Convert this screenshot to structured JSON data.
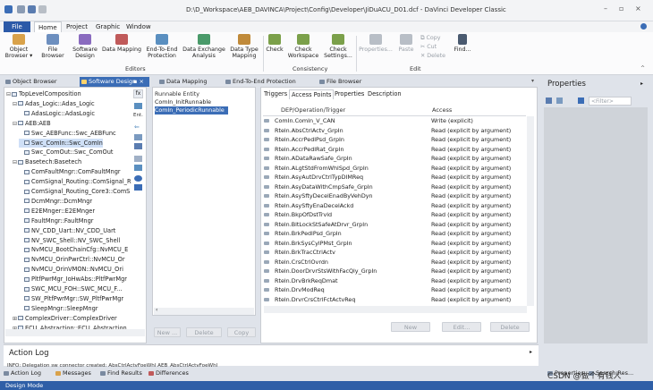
{
  "title_bar": {
    "title": "D:\\D_Workspace\\AEB_DAVINCA\\Project\\Config\\Developer\\JiDuACU_D01.dcf - DaVinci Developer Classic",
    "minimize": "–",
    "restore": "▫",
    "close": "×"
  },
  "menu": [
    "File",
    "Home",
    "Project",
    "Graphic",
    "Window"
  ],
  "ribbon": {
    "buttons": [
      {
        "label1": "Object",
        "label2": "Browser ▾",
        "icon": "object-browser-icon",
        "color": "#d9a24a"
      },
      {
        "label1": "File",
        "label2": "Browser",
        "icon": "file-browser-icon",
        "color": "#6d8fbf"
      },
      {
        "label1": "Software",
        "label2": "Design",
        "icon": "software-design-icon",
        "color": "#8a6bbf"
      },
      {
        "label1": "Data Mapping",
        "label2": "",
        "icon": "data-mapping-icon",
        "color": "#c05a5a"
      },
      {
        "label1": "End-To-End",
        "label2": "Protection",
        "icon": "end-to-end-icon",
        "color": "#5a8fc0"
      },
      {
        "label1": "Data Exchange",
        "label2": "Analysis",
        "icon": "data-exchange-icon",
        "color": "#4a9a6a"
      },
      {
        "label1": "Data Type",
        "label2": "Mapping",
        "icon": "data-type-mapping-icon",
        "color": "#c08a3a"
      },
      {
        "label1": "Check",
        "label2": "",
        "icon": "check-icon",
        "color": "#7ba04a"
      },
      {
        "label1": "Check",
        "label2": "Workspace",
        "icon": "check-workspace-icon",
        "color": "#7ba04a"
      },
      {
        "label1": "Check",
        "label2": "Settings...",
        "icon": "check-settings-icon",
        "color": "#7ba04a"
      },
      {
        "label1": "Properties...",
        "label2": "",
        "icon": "properties-icon",
        "color": "#b8bec6"
      },
      {
        "label1": "Paste",
        "label2": "",
        "icon": "paste-icon",
        "color": "#b8bec6"
      },
      {
        "label1": "Find...",
        "label2": "",
        "icon": "find-icon",
        "color": "#4a5a70"
      }
    ],
    "small": [
      "Copy",
      "Cut",
      "Delete"
    ],
    "groups": [
      "Editors",
      "Consistency",
      "Edit"
    ]
  },
  "doc_tabs": [
    {
      "label": "Object Browser",
      "active": false
    },
    {
      "label": "Software Design",
      "active": true
    },
    {
      "label": "Data Mapping",
      "active": false
    },
    {
      "label": "End-To-End Protection",
      "active": false
    },
    {
      "label": "File Browser",
      "active": false
    }
  ],
  "tree": [
    {
      "label": "TopLevelComposition",
      "level": 0,
      "exp": "⊟"
    },
    {
      "label": "Adas_Logic::Adas_Logic",
      "level": 1,
      "exp": "⊟"
    },
    {
      "label": "AdasLogic::AdasLogic",
      "level": 2,
      "exp": ""
    },
    {
      "label": "AEB:AEB",
      "level": 1,
      "exp": "⊟"
    },
    {
      "label": "Swc_AEBFunc::Swc_AEBFunc",
      "level": 2,
      "exp": ""
    },
    {
      "label": "Swc_ComIn::Swc_ComIn",
      "level": 2,
      "exp": "",
      "selected": true
    },
    {
      "label": "Swc_ComOut::Swc_ComOut",
      "level": 2,
      "exp": ""
    },
    {
      "label": "Basetech:Basetech",
      "level": 1,
      "exp": "⊟"
    },
    {
      "label": "ComFaultMngr::ComFaultMngr",
      "level": 2,
      "exp": ""
    },
    {
      "label": "ComSignal_Routing::ComSignal_R",
      "level": 2,
      "exp": ""
    },
    {
      "label": "ComSignal_Routing_Core3::ComS",
      "level": 2,
      "exp": ""
    },
    {
      "label": "DcmMngr::DcmMngr",
      "level": 2,
      "exp": ""
    },
    {
      "label": "E2EMnger::E2EMnger",
      "level": 2,
      "exp": ""
    },
    {
      "label": "FaultMngr::FaultMngr",
      "level": 2,
      "exp": ""
    },
    {
      "label": "NV_CDD_Uart::NV_CDD_Uart",
      "level": 2,
      "exp": ""
    },
    {
      "label": "NV_SWC_Shell::NV_SWC_Shell",
      "level": 2,
      "exp": ""
    },
    {
      "label": "NvMCU_BootChainCfg::NvMCU_E",
      "level": 2,
      "exp": ""
    },
    {
      "label": "NvMCU_OrinPwrCtrl::NvMCU_Or",
      "level": 2,
      "exp": ""
    },
    {
      "label": "NvMCU_OrinVMON::NvMCU_Ori",
      "level": 2,
      "exp": ""
    },
    {
      "label": "PltfPwrMgr_IoHwAbs::PltfPwrMgr",
      "level": 2,
      "exp": ""
    },
    {
      "label": "SWC_MCU_FOH::SWC_MCU_F...",
      "level": 2,
      "exp": ""
    },
    {
      "label": "SW_PltfPwrMgr::SW_PltfPwrMgr",
      "level": 2,
      "exp": ""
    },
    {
      "label": "SleepMngr::SleepMngr",
      "level": 2,
      "exp": ""
    },
    {
      "label": "ComplexDriver::ComplexDriver",
      "level": 1,
      "exp": "⊞"
    },
    {
      "label": "ECU_Abstraction::ECU_Abstraction",
      "level": 1,
      "exp": "⊞"
    }
  ],
  "runnables": {
    "header": "Runnable Entity",
    "items": [
      "ComIn_InitRunnable",
      "ComIn_PeriodicRunnable"
    ],
    "selected_index": 1,
    "buttons": [
      "New ...",
      "Delete",
      "Copy"
    ]
  },
  "access_panel": {
    "tabs": [
      "Triggers",
      "Access Points",
      "Properties",
      "Description"
    ],
    "active_tab": 1,
    "col1": "DEP/Operation/Trigger",
    "col2": "Access",
    "rows": [
      {
        "name": "ComIn.ComIn_V_CAN",
        "access": "Write (explicit)"
      },
      {
        "name": "Rteln.AbsCtrlActv_GrpIn",
        "access": "Read (explicit by argument)"
      },
      {
        "name": "Rteln.AccrPedlPsd_GrpIn",
        "access": "Read (explicit by argument)"
      },
      {
        "name": "Rteln.AccrPedlRat_GrpIn",
        "access": "Read (explicit by argument)"
      },
      {
        "name": "Rteln.ADataRawSafe_GrpIn",
        "access": "Read (explicit by argument)"
      },
      {
        "name": "Rteln.ALgtStdFromWhlSpd_GrpIn",
        "access": "Read (explicit by argument)"
      },
      {
        "name": "Rteln.AsyAutDrvCtrlTypDIMReq",
        "access": "Read (explicit by argument)"
      },
      {
        "name": "Rteln.AsyDataWithCmpSafe_GrpIn",
        "access": "Read (explicit by argument)"
      },
      {
        "name": "Rteln.AsySftyDecelEnadByVehDyn",
        "access": "Read (explicit by argument)"
      },
      {
        "name": "Rteln.AsySftyEnaDecelAckd",
        "access": "Read (explicit by argument)"
      },
      {
        "name": "Rteln.BkpOfDstTrvld",
        "access": "Read (explicit by argument)"
      },
      {
        "name": "Rteln.BltLockStSafeAtDrvr_GrpIn",
        "access": "Read (explicit by argument)"
      },
      {
        "name": "Rteln.BrkPedlPsd_GrpIn",
        "access": "Read (explicit by argument)"
      },
      {
        "name": "Rteln.BrkSysCylPMst_GrpIn",
        "access": "Read (explicit by argument)"
      },
      {
        "name": "Rteln.BrkTracCtrlActv",
        "access": "Read (explicit by argument)"
      },
      {
        "name": "Rteln.CrsCtrlOvrdn",
        "access": "Read (explicit by argument)"
      },
      {
        "name": "Rteln.DoorDrvrStsWithFacQly_GrpIn",
        "access": "Read (explicit by argument)"
      },
      {
        "name": "Rteln.DrvBrkReqDmat",
        "access": "Read (explicit by argument)"
      },
      {
        "name": "Rteln.DrvModReq",
        "access": "Read (explicit by argument)"
      },
      {
        "name": "Rteln.DrvrCrsCtrlFctActvReq",
        "access": "Read (explicit by argument)"
      }
    ],
    "buttons": [
      "New",
      "Edit...",
      "Delete"
    ]
  },
  "properties": {
    "title": "Properties",
    "filter_placeholder": "<Filter>"
  },
  "action_log": {
    "title": "Action Log",
    "message": "INFO: Delegation sw connector created: AbsCtrlActvFoeWhl  AEB_AbsCtrlActvFoeWhl"
  },
  "bottom_tabs": [
    "Action Log",
    "Messages",
    "Find Results",
    "Differences"
  ],
  "bottom_right_tabs": [
    "Properties",
    "Search Res..."
  ],
  "status": "Design Mode",
  "watermark": "CSDN @做个有钱人",
  "colors": {
    "accent": "#3b6db6",
    "status": "#2f5fa7"
  }
}
